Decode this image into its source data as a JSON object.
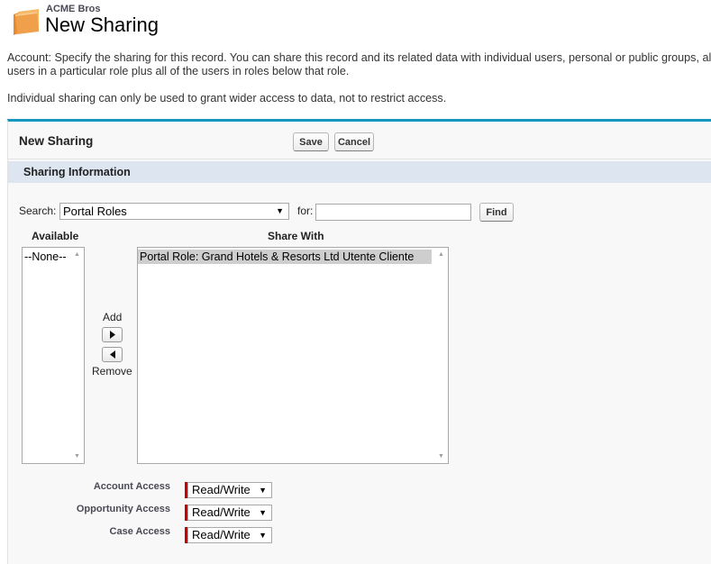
{
  "header": {
    "org_name": "ACME Bros",
    "title": "New Sharing"
  },
  "description": {
    "line1": "Account: Specify the sharing for this record. You can share this record and its related data with individual users, personal or public groups, all",
    "line2": "users in a particular role plus all of the users in roles below that role.",
    "line3": "Individual sharing can only be used to grant wider access to data, not to restrict access."
  },
  "panel": {
    "title": "New Sharing",
    "save_label": "Save",
    "cancel_label": "Cancel",
    "section_title": "Sharing Information"
  },
  "search": {
    "label": "Search:",
    "selected": "Portal Roles",
    "for_label": "for:",
    "query": "",
    "find_label": "Find"
  },
  "available": {
    "header": "Available",
    "options": [
      "--None--"
    ]
  },
  "share_with": {
    "header": "Share With",
    "options": [
      "Portal Role: Grand Hotels & Resorts Ltd Utente Cliente"
    ]
  },
  "move": {
    "add_label": "Add",
    "remove_label": "Remove"
  },
  "access": [
    {
      "label": "Account Access",
      "value": "Read/Write"
    },
    {
      "label": "Opportunity Access",
      "value": "Read/Write"
    },
    {
      "label": "Case Access",
      "value": "Read/Write"
    }
  ],
  "icons": {
    "page": "folder-icon",
    "dropdown": "caret-down-icon",
    "add": "arrow-right-icon",
    "remove": "arrow-left-icon"
  },
  "colors": {
    "panel_top_border": "#1797c0",
    "section_bar": "#dce5f0",
    "required": "#cc0000",
    "folder": "#f0a04a"
  }
}
